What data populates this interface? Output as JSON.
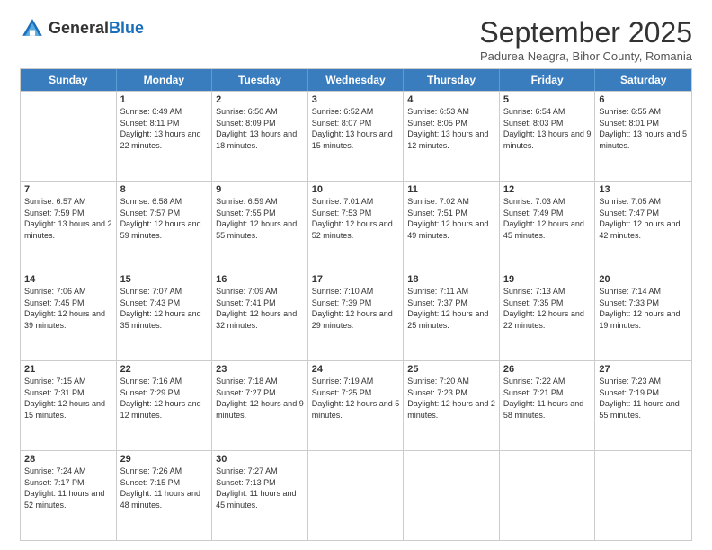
{
  "logo": {
    "general": "General",
    "blue": "Blue"
  },
  "header": {
    "month": "September 2025",
    "subtitle": "Padurea Neagra, Bihor County, Romania"
  },
  "days_of_week": [
    "Sunday",
    "Monday",
    "Tuesday",
    "Wednesday",
    "Thursday",
    "Friday",
    "Saturday"
  ],
  "weeks": [
    [
      {
        "day": "",
        "sunrise": "",
        "sunset": "",
        "daylight": ""
      },
      {
        "day": "1",
        "sunrise": "Sunrise: 6:49 AM",
        "sunset": "Sunset: 8:11 PM",
        "daylight": "Daylight: 13 hours and 22 minutes."
      },
      {
        "day": "2",
        "sunrise": "Sunrise: 6:50 AM",
        "sunset": "Sunset: 8:09 PM",
        "daylight": "Daylight: 13 hours and 18 minutes."
      },
      {
        "day": "3",
        "sunrise": "Sunrise: 6:52 AM",
        "sunset": "Sunset: 8:07 PM",
        "daylight": "Daylight: 13 hours and 15 minutes."
      },
      {
        "day": "4",
        "sunrise": "Sunrise: 6:53 AM",
        "sunset": "Sunset: 8:05 PM",
        "daylight": "Daylight: 13 hours and 12 minutes."
      },
      {
        "day": "5",
        "sunrise": "Sunrise: 6:54 AM",
        "sunset": "Sunset: 8:03 PM",
        "daylight": "Daylight: 13 hours and 9 minutes."
      },
      {
        "day": "6",
        "sunrise": "Sunrise: 6:55 AM",
        "sunset": "Sunset: 8:01 PM",
        "daylight": "Daylight: 13 hours and 5 minutes."
      }
    ],
    [
      {
        "day": "7",
        "sunrise": "Sunrise: 6:57 AM",
        "sunset": "Sunset: 7:59 PM",
        "daylight": "Daylight: 13 hours and 2 minutes."
      },
      {
        "day": "8",
        "sunrise": "Sunrise: 6:58 AM",
        "sunset": "Sunset: 7:57 PM",
        "daylight": "Daylight: 12 hours and 59 minutes."
      },
      {
        "day": "9",
        "sunrise": "Sunrise: 6:59 AM",
        "sunset": "Sunset: 7:55 PM",
        "daylight": "Daylight: 12 hours and 55 minutes."
      },
      {
        "day": "10",
        "sunrise": "Sunrise: 7:01 AM",
        "sunset": "Sunset: 7:53 PM",
        "daylight": "Daylight: 12 hours and 52 minutes."
      },
      {
        "day": "11",
        "sunrise": "Sunrise: 7:02 AM",
        "sunset": "Sunset: 7:51 PM",
        "daylight": "Daylight: 12 hours and 49 minutes."
      },
      {
        "day": "12",
        "sunrise": "Sunrise: 7:03 AM",
        "sunset": "Sunset: 7:49 PM",
        "daylight": "Daylight: 12 hours and 45 minutes."
      },
      {
        "day": "13",
        "sunrise": "Sunrise: 7:05 AM",
        "sunset": "Sunset: 7:47 PM",
        "daylight": "Daylight: 12 hours and 42 minutes."
      }
    ],
    [
      {
        "day": "14",
        "sunrise": "Sunrise: 7:06 AM",
        "sunset": "Sunset: 7:45 PM",
        "daylight": "Daylight: 12 hours and 39 minutes."
      },
      {
        "day": "15",
        "sunrise": "Sunrise: 7:07 AM",
        "sunset": "Sunset: 7:43 PM",
        "daylight": "Daylight: 12 hours and 35 minutes."
      },
      {
        "day": "16",
        "sunrise": "Sunrise: 7:09 AM",
        "sunset": "Sunset: 7:41 PM",
        "daylight": "Daylight: 12 hours and 32 minutes."
      },
      {
        "day": "17",
        "sunrise": "Sunrise: 7:10 AM",
        "sunset": "Sunset: 7:39 PM",
        "daylight": "Daylight: 12 hours and 29 minutes."
      },
      {
        "day": "18",
        "sunrise": "Sunrise: 7:11 AM",
        "sunset": "Sunset: 7:37 PM",
        "daylight": "Daylight: 12 hours and 25 minutes."
      },
      {
        "day": "19",
        "sunrise": "Sunrise: 7:13 AM",
        "sunset": "Sunset: 7:35 PM",
        "daylight": "Daylight: 12 hours and 22 minutes."
      },
      {
        "day": "20",
        "sunrise": "Sunrise: 7:14 AM",
        "sunset": "Sunset: 7:33 PM",
        "daylight": "Daylight: 12 hours and 19 minutes."
      }
    ],
    [
      {
        "day": "21",
        "sunrise": "Sunrise: 7:15 AM",
        "sunset": "Sunset: 7:31 PM",
        "daylight": "Daylight: 12 hours and 15 minutes."
      },
      {
        "day": "22",
        "sunrise": "Sunrise: 7:16 AM",
        "sunset": "Sunset: 7:29 PM",
        "daylight": "Daylight: 12 hours and 12 minutes."
      },
      {
        "day": "23",
        "sunrise": "Sunrise: 7:18 AM",
        "sunset": "Sunset: 7:27 PM",
        "daylight": "Daylight: 12 hours and 9 minutes."
      },
      {
        "day": "24",
        "sunrise": "Sunrise: 7:19 AM",
        "sunset": "Sunset: 7:25 PM",
        "daylight": "Daylight: 12 hours and 5 minutes."
      },
      {
        "day": "25",
        "sunrise": "Sunrise: 7:20 AM",
        "sunset": "Sunset: 7:23 PM",
        "daylight": "Daylight: 12 hours and 2 minutes."
      },
      {
        "day": "26",
        "sunrise": "Sunrise: 7:22 AM",
        "sunset": "Sunset: 7:21 PM",
        "daylight": "Daylight: 11 hours and 58 minutes."
      },
      {
        "day": "27",
        "sunrise": "Sunrise: 7:23 AM",
        "sunset": "Sunset: 7:19 PM",
        "daylight": "Daylight: 11 hours and 55 minutes."
      }
    ],
    [
      {
        "day": "28",
        "sunrise": "Sunrise: 7:24 AM",
        "sunset": "Sunset: 7:17 PM",
        "daylight": "Daylight: 11 hours and 52 minutes."
      },
      {
        "day": "29",
        "sunrise": "Sunrise: 7:26 AM",
        "sunset": "Sunset: 7:15 PM",
        "daylight": "Daylight: 11 hours and 48 minutes."
      },
      {
        "day": "30",
        "sunrise": "Sunrise: 7:27 AM",
        "sunset": "Sunset: 7:13 PM",
        "daylight": "Daylight: 11 hours and 45 minutes."
      },
      {
        "day": "",
        "sunrise": "",
        "sunset": "",
        "daylight": ""
      },
      {
        "day": "",
        "sunrise": "",
        "sunset": "",
        "daylight": ""
      },
      {
        "day": "",
        "sunrise": "",
        "sunset": "",
        "daylight": ""
      },
      {
        "day": "",
        "sunrise": "",
        "sunset": "",
        "daylight": ""
      }
    ]
  ]
}
